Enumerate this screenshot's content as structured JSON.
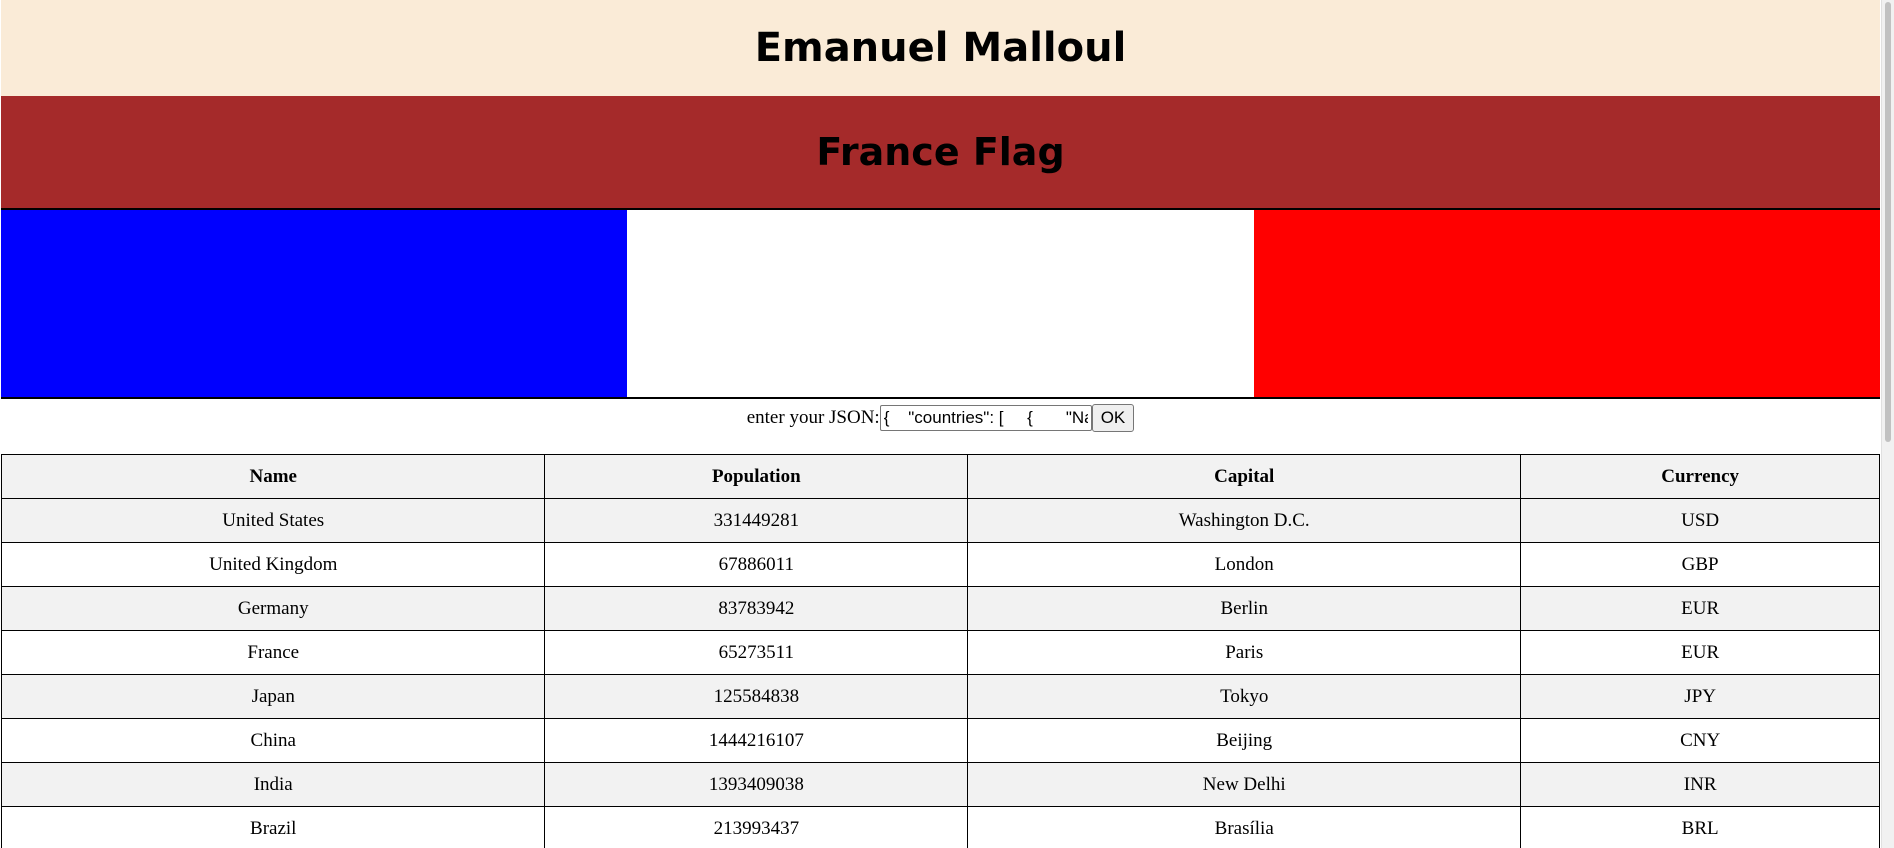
{
  "header": {
    "name": "Emanuel Malloul"
  },
  "flag_section": {
    "title": "France Flag",
    "colors": [
      "#0000ff",
      "#ffffff",
      "#ff0000"
    ]
  },
  "json_input": {
    "label": "enter your JSON:",
    "value": "{    \"countries\": [     {       \"Name\": \"United States\",",
    "button_label": "OK"
  },
  "table": {
    "headers": [
      "Name",
      "Population",
      "Capital",
      "Currency"
    ],
    "rows": [
      [
        "United States",
        "331449281",
        "Washington D.C.",
        "USD"
      ],
      [
        "United Kingdom",
        "67886011",
        "London",
        "GBP"
      ],
      [
        "Germany",
        "83783942",
        "Berlin",
        "EUR"
      ],
      [
        "France",
        "65273511",
        "Paris",
        "EUR"
      ],
      [
        "Japan",
        "125584838",
        "Tokyo",
        "JPY"
      ],
      [
        "China",
        "1444216107",
        "Beijing",
        "CNY"
      ],
      [
        "India",
        "1393409038",
        "New Delhi",
        "INR"
      ],
      [
        "Brazil",
        "213993437",
        "Brasília",
        "BRL"
      ]
    ]
  }
}
